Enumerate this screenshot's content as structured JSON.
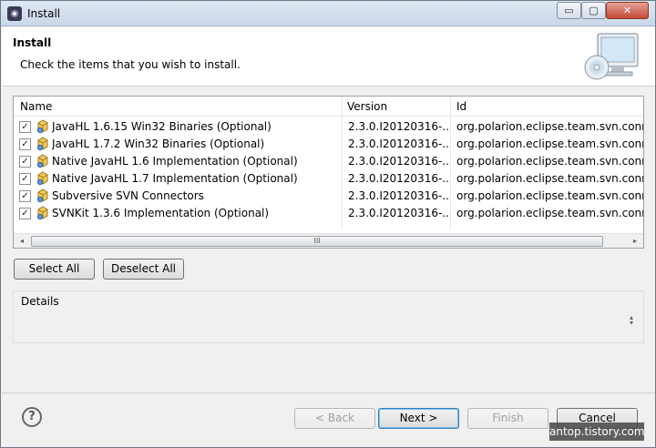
{
  "window": {
    "title": "Install",
    "controls": {
      "minimize": "▭",
      "maximize": "▢",
      "close": "✕"
    }
  },
  "header": {
    "title": "Install",
    "description": "Check the items that you wish to install."
  },
  "table": {
    "columns": [
      "Name",
      "Version",
      "Id"
    ],
    "rows": [
      {
        "checked": true,
        "name": "JavaHL 1.6.15 Win32 Binaries (Optional)",
        "version": "2.3.0.I20120316-...",
        "id": "org.polarion.eclipse.team.svn.connector"
      },
      {
        "checked": true,
        "name": "JavaHL 1.7.2 Win32 Binaries (Optional)",
        "version": "2.3.0.I20120316-...",
        "id": "org.polarion.eclipse.team.svn.connector"
      },
      {
        "checked": true,
        "name": "Native JavaHL 1.6 Implementation (Optional)",
        "version": "2.3.0.I20120316-...",
        "id": "org.polarion.eclipse.team.svn.connector"
      },
      {
        "checked": true,
        "name": "Native JavaHL 1.7 Implementation (Optional)",
        "version": "2.3.0.I20120316-...",
        "id": "org.polarion.eclipse.team.svn.connector"
      },
      {
        "checked": true,
        "name": "Subversive SVN Connectors",
        "version": "2.3.0.I20120316-...",
        "id": "org.polarion.eclipse.team.svn.connector"
      },
      {
        "checked": true,
        "name": "SVNKit 1.3.6 Implementation (Optional)",
        "version": "2.3.0.I20120316-...",
        "id": "org.polarion.eclipse.team.svn.connector"
      }
    ],
    "scrollbar": {
      "left_arrow": "◂",
      "right_arrow": "▸",
      "grip": "III"
    }
  },
  "selection_buttons": {
    "select_all": "Select All",
    "deselect_all": "Deselect All"
  },
  "details": {
    "label": "Details"
  },
  "footer": {
    "help_icon": "?",
    "back": "< Back",
    "next": "Next >",
    "finish": "Finish",
    "cancel": "Cancel"
  },
  "watermark": "antop.tistory.com",
  "colors": {
    "banner_bg": "#ffffff",
    "window_bg": "#f0f0f0",
    "close_button": "#c24b36"
  }
}
